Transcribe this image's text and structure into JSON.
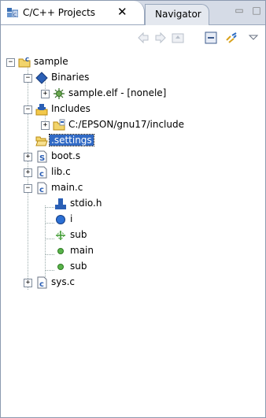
{
  "tabs": [
    {
      "label": "C/C++ Projects",
      "active": true,
      "close_icon": "close-icon"
    },
    {
      "label": "Navigator",
      "active": false
    }
  ],
  "toolbar": {
    "icons": [
      "back-icon",
      "forward-icon",
      "up-icon",
      "collapse-all-icon",
      "link-editor-icon",
      "view-menu-icon"
    ]
  },
  "tree": {
    "sample": "sample",
    "binaries": "Binaries",
    "sample_elf": "sample.elf - [nonele]",
    "includes": "Includes",
    "include_path": "C:/EPSON/gnu17/include",
    "settings": ".settings",
    "boot_s": "boot.s",
    "lib_c": "lib.c",
    "main_c": "main.c",
    "stdio_h": "stdio.h",
    "var_i": "i",
    "sub_decl": "sub",
    "main_fn": "main",
    "sub_fn": "sub",
    "sys_c": "sys.c"
  },
  "colors": {
    "selection": "#316ac5",
    "tabbar": "#d5dbe6",
    "border": "#8c9ab0"
  }
}
